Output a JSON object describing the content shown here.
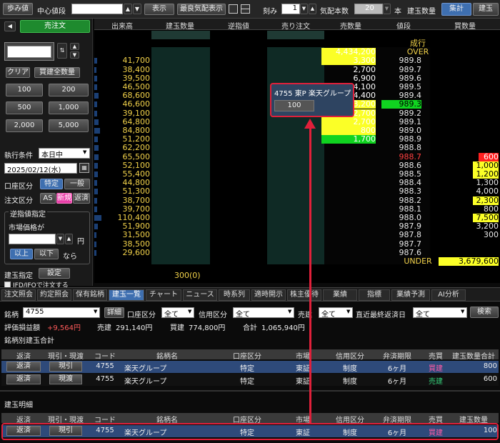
{
  "toolbar": {
    "ayumine": "歩み値",
    "center_label": "中心値段",
    "show": "表示",
    "best_quote": "最良気配表示",
    "tick_label": "刻み",
    "tick_value": "1",
    "quote_count_label": "気配本数",
    "quote_count_value": "20",
    "hon": "本",
    "position_qty_label": "建玉数量",
    "aggregate": "集計",
    "position": "建玉"
  },
  "left": {
    "sell_order": "売注文",
    "clear": "クリア",
    "buy_all": "買建全数量",
    "qty_buttons": [
      "100",
      "200",
      "500",
      "1,000",
      "2,000",
      "5,000"
    ],
    "exec_cond_label": "執行条件",
    "exec_cond_value": "本日中",
    "date_value": "2025/02/12(水)",
    "account_label": "口座区分",
    "account_specific": "特定",
    "account_general": "一般",
    "order_type_label": "注文区分",
    "order_as": "AS",
    "order_new": "新規",
    "order_repay": "返済",
    "stop_title": "逆指値指定",
    "market_price_label": "市場価格が",
    "yen": "円",
    "above": "以上",
    "below": "以下",
    "nara": "なら",
    "position_spec_label": "建玉指定",
    "settings": "設定",
    "ifd_text": "IFD/IFOで注文する"
  },
  "board": {
    "headers": [
      "出来高",
      "建玉数量",
      "逆指値",
      "売り注文",
      "売数量",
      "値段",
      "買数量"
    ],
    "rows": [
      {
        "vol": "",
        "ask": "",
        "price": "成行",
        "bid": ""
      },
      {
        "vol": "",
        "ask": "4,434,200",
        "price": "OVER",
        "bid": ""
      },
      {
        "vol": "41,700",
        "ask": "3,300",
        "price": "989.8",
        "bid": ""
      },
      {
        "vol": "38,400",
        "ask": "2,700",
        "price": "989.7",
        "bid": ""
      },
      {
        "vol": "39,500",
        "ask": "6,900",
        "price": "989.6",
        "bid": ""
      },
      {
        "vol": "46,500",
        "ask": "4,100",
        "price": "989.5",
        "bid": ""
      },
      {
        "vol": "68,600",
        "ask": "4,400",
        "price": "989.4",
        "bid": ""
      },
      {
        "vol": "46,600",
        "ask": "3,200",
        "price": "989.3",
        "bid": ""
      },
      {
        "vol": "39,100",
        "ask": "2,700",
        "price": "989.2",
        "bid": ""
      },
      {
        "vol": "64,800",
        "ask": "2,700",
        "price": "989.1",
        "bid": ""
      },
      {
        "vol": "84,800",
        "ask": "800",
        "price": "989.0",
        "bid": ""
      },
      {
        "vol": "51,200",
        "ask": "1,700",
        "price": "988.9",
        "bid": ""
      },
      {
        "vol": "62,200",
        "ask": "",
        "price": "988.8",
        "bid": ""
      },
      {
        "vol": "65,500",
        "ask": "",
        "price": "988.7",
        "bid": "600"
      },
      {
        "vol": "52,100",
        "ask": "",
        "price": "988.6",
        "bid": "1,000"
      },
      {
        "vol": "55,400",
        "ask": "",
        "price": "988.5",
        "bid": "1,200"
      },
      {
        "vol": "44,800",
        "ask": "",
        "price": "988.4",
        "bid": "1,300"
      },
      {
        "vol": "51,300",
        "ask": "",
        "price": "988.3",
        "bid": "4,000"
      },
      {
        "vol": "38,700",
        "ask": "",
        "price": "988.2",
        "bid": "2,300"
      },
      {
        "vol": "39,700",
        "ask": "",
        "price": "988.1",
        "bid": "800"
      },
      {
        "vol": "110,400",
        "ask": "",
        "price": "988.0",
        "bid": "7,500"
      },
      {
        "vol": "51,900",
        "ask": "",
        "price": "987.9",
        "bid": "3,200"
      },
      {
        "vol": "31,500",
        "ask": "",
        "price": "987.8",
        "bid": "300"
      },
      {
        "vol": "38,500",
        "ask": "",
        "price": "987.7",
        "bid": ""
      },
      {
        "vol": "29,600",
        "ask": "",
        "price": "987.6",
        "bid": ""
      },
      {
        "vol": "",
        "ask": "",
        "price": "UNDER",
        "bid": "3,679,600"
      }
    ],
    "position_total": "300(0)",
    "popup_title": "4755 東P 楽天グループ",
    "popup_qty": "100"
  },
  "tabs": [
    "注文照会",
    "約定照会",
    "保有銘柄",
    "建玉一覧",
    "チャート",
    "ニュース",
    "時系列",
    "適時開示",
    "株主優待",
    "業績",
    "指標",
    "業績予測",
    "AI分析"
  ],
  "active_tab": 3,
  "filter": {
    "symbol_label": "銘柄",
    "symbol_value": "4755",
    "detail": "詳細",
    "account_label": "口座区分",
    "account_value": "全て",
    "credit_label": "信用区分",
    "credit_value": "全て",
    "side_label": "売建",
    "side_value": "全て",
    "due_label": "直近最終返済日",
    "due_value": "全て",
    "search": "検索"
  },
  "summary": {
    "pl_label": "評価損益額",
    "pl_value": "+9,564円",
    "sell_label": "売建",
    "sell_value": "291,140円",
    "buy_label": "買建",
    "buy_value": "774,800円",
    "total_label": "合計",
    "total_value": "1,065,940円",
    "section_title": "銘柄別建玉合計"
  },
  "grid_headers": [
    "返済",
    "現引・現渡",
    "コード",
    "銘柄名",
    "口座区分",
    "市場",
    "信用区分",
    "弁済期限",
    "売買",
    "建玉数量合計"
  ],
  "grid_rows": [
    {
      "a": "返済",
      "b": "現引",
      "code": "4755",
      "name": "楽天グループ",
      "acct": "特定",
      "mkt": "東証",
      "credit": "制度",
      "due": "6ヶ月",
      "side": "買建",
      "qty": "800"
    },
    {
      "a": "返済",
      "b": "現渡",
      "code": "4755",
      "name": "楽天グループ",
      "acct": "特定",
      "mkt": "東証",
      "credit": "制度",
      "due": "6ヶ月",
      "side": "売建",
      "qty": "600"
    }
  ],
  "detail_title": "建玉明細",
  "detail_headers": [
    "返済",
    "現引・現渡",
    "コード",
    "銘柄名",
    "口座区分",
    "市場",
    "信用区分",
    "弁済期限",
    "売買",
    "建玉数量"
  ],
  "detail_row": {
    "a": "返済",
    "b": "現引",
    "code": "4755",
    "name": "楽天グループ",
    "acct": "特定",
    "mkt": "東証",
    "credit": "制度",
    "due": "6ヶ月",
    "side": "買建",
    "qty": "100"
  },
  "colors": {
    "accent": "#3e6fb0",
    "buy": "#ff5aa5",
    "sell": "#35d07a",
    "highlight": "#e0203a",
    "board_yellow": "#fbff27",
    "board_green": "#10d420"
  }
}
